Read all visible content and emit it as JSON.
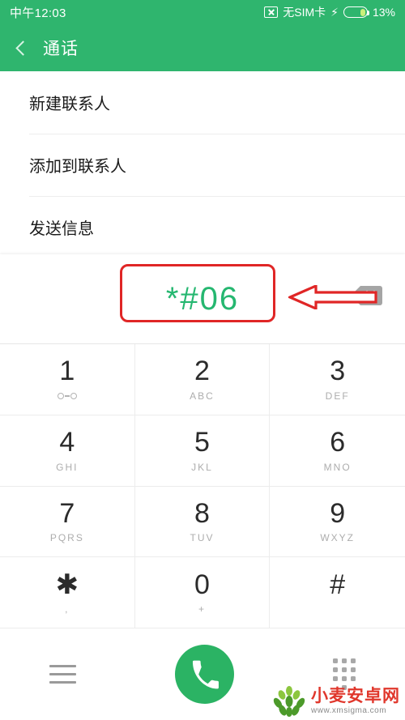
{
  "statusbar": {
    "clock": "中午12:03",
    "sim_label": "无SIM卡",
    "sim_icon": "no-sim-icon",
    "charging_icon": "lightning-bolt-icon",
    "battery_icon": "battery-icon",
    "battery_percent": "13%"
  },
  "appbar": {
    "back_icon": "back-chevron-icon",
    "title": "通话"
  },
  "menu": {
    "items": [
      {
        "label": "新建联系人"
      },
      {
        "label": "添加到联系人"
      },
      {
        "label": "发送信息"
      }
    ]
  },
  "dialer": {
    "number": "*#06",
    "number_color": "#25b770",
    "backspace_icon": "backspace-delete-icon",
    "annotation_color": "#e02626",
    "annotation_box": "red-highlight-box",
    "annotation_arrow": "red-arrow-pointing-left"
  },
  "keypad": {
    "keys": [
      {
        "digit": "1",
        "sub": "",
        "sub_icon": "voicemail-icon"
      },
      {
        "digit": "2",
        "sub": "ABC",
        "sub_icon": ""
      },
      {
        "digit": "3",
        "sub": "DEF",
        "sub_icon": ""
      },
      {
        "digit": "4",
        "sub": "GHI",
        "sub_icon": ""
      },
      {
        "digit": "5",
        "sub": "JKL",
        "sub_icon": ""
      },
      {
        "digit": "6",
        "sub": "MNO",
        "sub_icon": ""
      },
      {
        "digit": "7",
        "sub": "PQRS",
        "sub_icon": ""
      },
      {
        "digit": "8",
        "sub": "TUV",
        "sub_icon": ""
      },
      {
        "digit": "9",
        "sub": "WXYZ",
        "sub_icon": ""
      },
      {
        "digit": "✱",
        "sub": ",",
        "sub_icon": ""
      },
      {
        "digit": "0",
        "sub": "+",
        "sub_icon": ""
      },
      {
        "digit": "#",
        "sub": "",
        "sub_icon": ""
      }
    ]
  },
  "bottombar": {
    "menu_icon": "hamburger-menu-icon",
    "call_icon": "phone-call-icon",
    "call_button_color": "#2bb364",
    "dialpad_icon": "dialpad-grid-icon"
  },
  "watermark": {
    "logo_icon": "wheat-logo-icon",
    "title": "小麦安卓网",
    "url": "www.xmsigma.com"
  },
  "theme": {
    "primary_green": "#2fb56e",
    "accent_red": "#e02626",
    "number_green": "#25b770"
  }
}
